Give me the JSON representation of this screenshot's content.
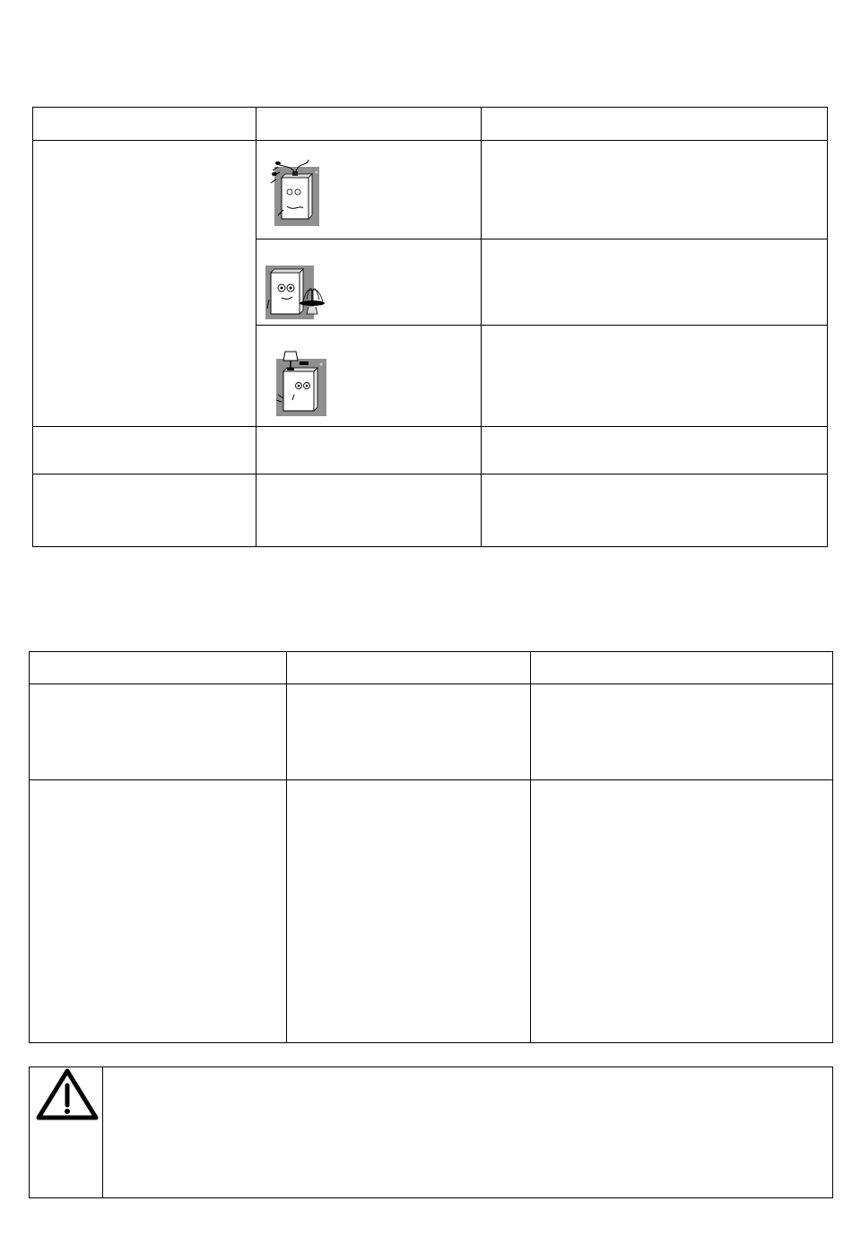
{
  "table1": {
    "illustrations": [
      {
        "name": "fridge-plant-illustration"
      },
      {
        "name": "fridge-fountain-illustration"
      },
      {
        "name": "fridge-lamp-illustration"
      }
    ]
  },
  "table2": {},
  "warning": {
    "icon": "warning-triangle-icon"
  }
}
